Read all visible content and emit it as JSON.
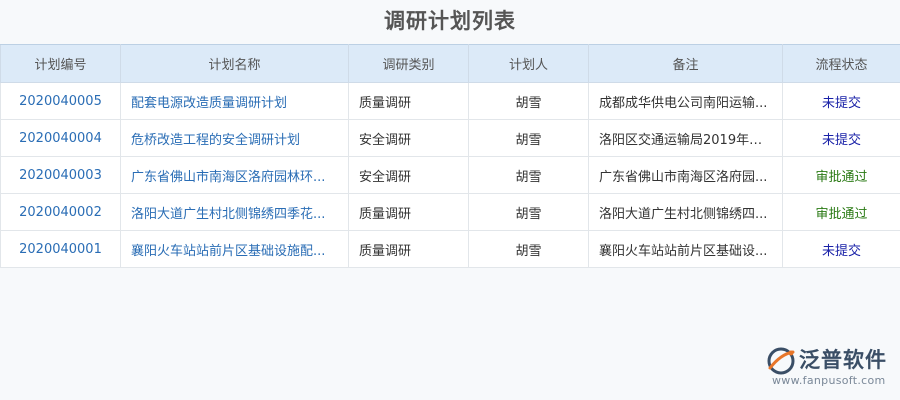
{
  "page": {
    "title": "调研计划列表"
  },
  "table": {
    "headers": {
      "id": "计划编号",
      "name": "计划名称",
      "type": "调研类别",
      "person": "计划人",
      "note": "备注",
      "status": "流程状态"
    },
    "rows": [
      {
        "id": "2020040005",
        "name": "配套电源改造质量调研计划",
        "type": "质量调研",
        "person": "胡雪",
        "note": "成都成华供电公司南阳运输...",
        "status": "未提交"
      },
      {
        "id": "2020040004",
        "name": "危桥改造工程的安全调研计划",
        "type": "安全调研",
        "person": "胡雪",
        "note": "洛阳区交通运输局2019年第...",
        "status": "未提交"
      },
      {
        "id": "2020040003",
        "name": "广东省佛山市南海区洛府园林环...",
        "type": "安全调研",
        "person": "胡雪",
        "note": "广东省佛山市南海区洛府园...",
        "status": "审批通过"
      },
      {
        "id": "2020040002",
        "name": "洛阳大道广生村北侧锦绣四季花...",
        "type": "质量调研",
        "person": "胡雪",
        "note": "洛阳大道广生村北侧锦绣四...",
        "status": "审批通过"
      },
      {
        "id": "2020040001",
        "name": "襄阳火车站站前片区基础设施配...",
        "type": "质量调研",
        "person": "胡雪",
        "note": "襄阳火车站站前片区基础设...",
        "status": "未提交"
      }
    ]
  },
  "status_colors": {
    "未提交": "#1a22a8",
    "审批通过": "#2a7a14"
  },
  "logo": {
    "name": "泛普软件",
    "url": "www.fanpusoft.com",
    "icon": "fanpu-logo-icon"
  }
}
